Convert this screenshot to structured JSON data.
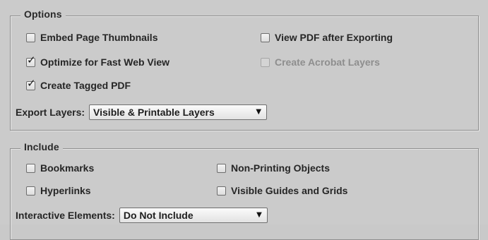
{
  "options": {
    "legend": "Options",
    "embed_thumbnails": {
      "label": "Embed Page Thumbnails",
      "checked": false,
      "enabled": true
    },
    "optimize_web": {
      "label": "Optimize for Fast Web View",
      "checked": true,
      "enabled": true
    },
    "tagged_pdf": {
      "label": "Create Tagged PDF",
      "checked": true,
      "enabled": true
    },
    "view_after": {
      "label": "View PDF after Exporting",
      "checked": false,
      "enabled": true
    },
    "acrobat_layers": {
      "label": "Create Acrobat Layers",
      "checked": false,
      "enabled": false
    },
    "export_layers": {
      "label": "Export Layers:",
      "value": "Visible & Printable Layers"
    }
  },
  "include": {
    "legend": "Include",
    "bookmarks": {
      "label": "Bookmarks",
      "checked": false,
      "enabled": true
    },
    "hyperlinks": {
      "label": "Hyperlinks",
      "checked": false,
      "enabled": true
    },
    "non_printing": {
      "label": "Non-Printing Objects",
      "checked": false,
      "enabled": true
    },
    "guides_grids": {
      "label": "Visible Guides and Grids",
      "checked": false,
      "enabled": true
    },
    "interactive": {
      "label": "Interactive Elements:",
      "value": "Do Not Include"
    }
  },
  "icons": {
    "check": "checkmark-icon",
    "dropdown": "dropdown-arrow-icon"
  }
}
